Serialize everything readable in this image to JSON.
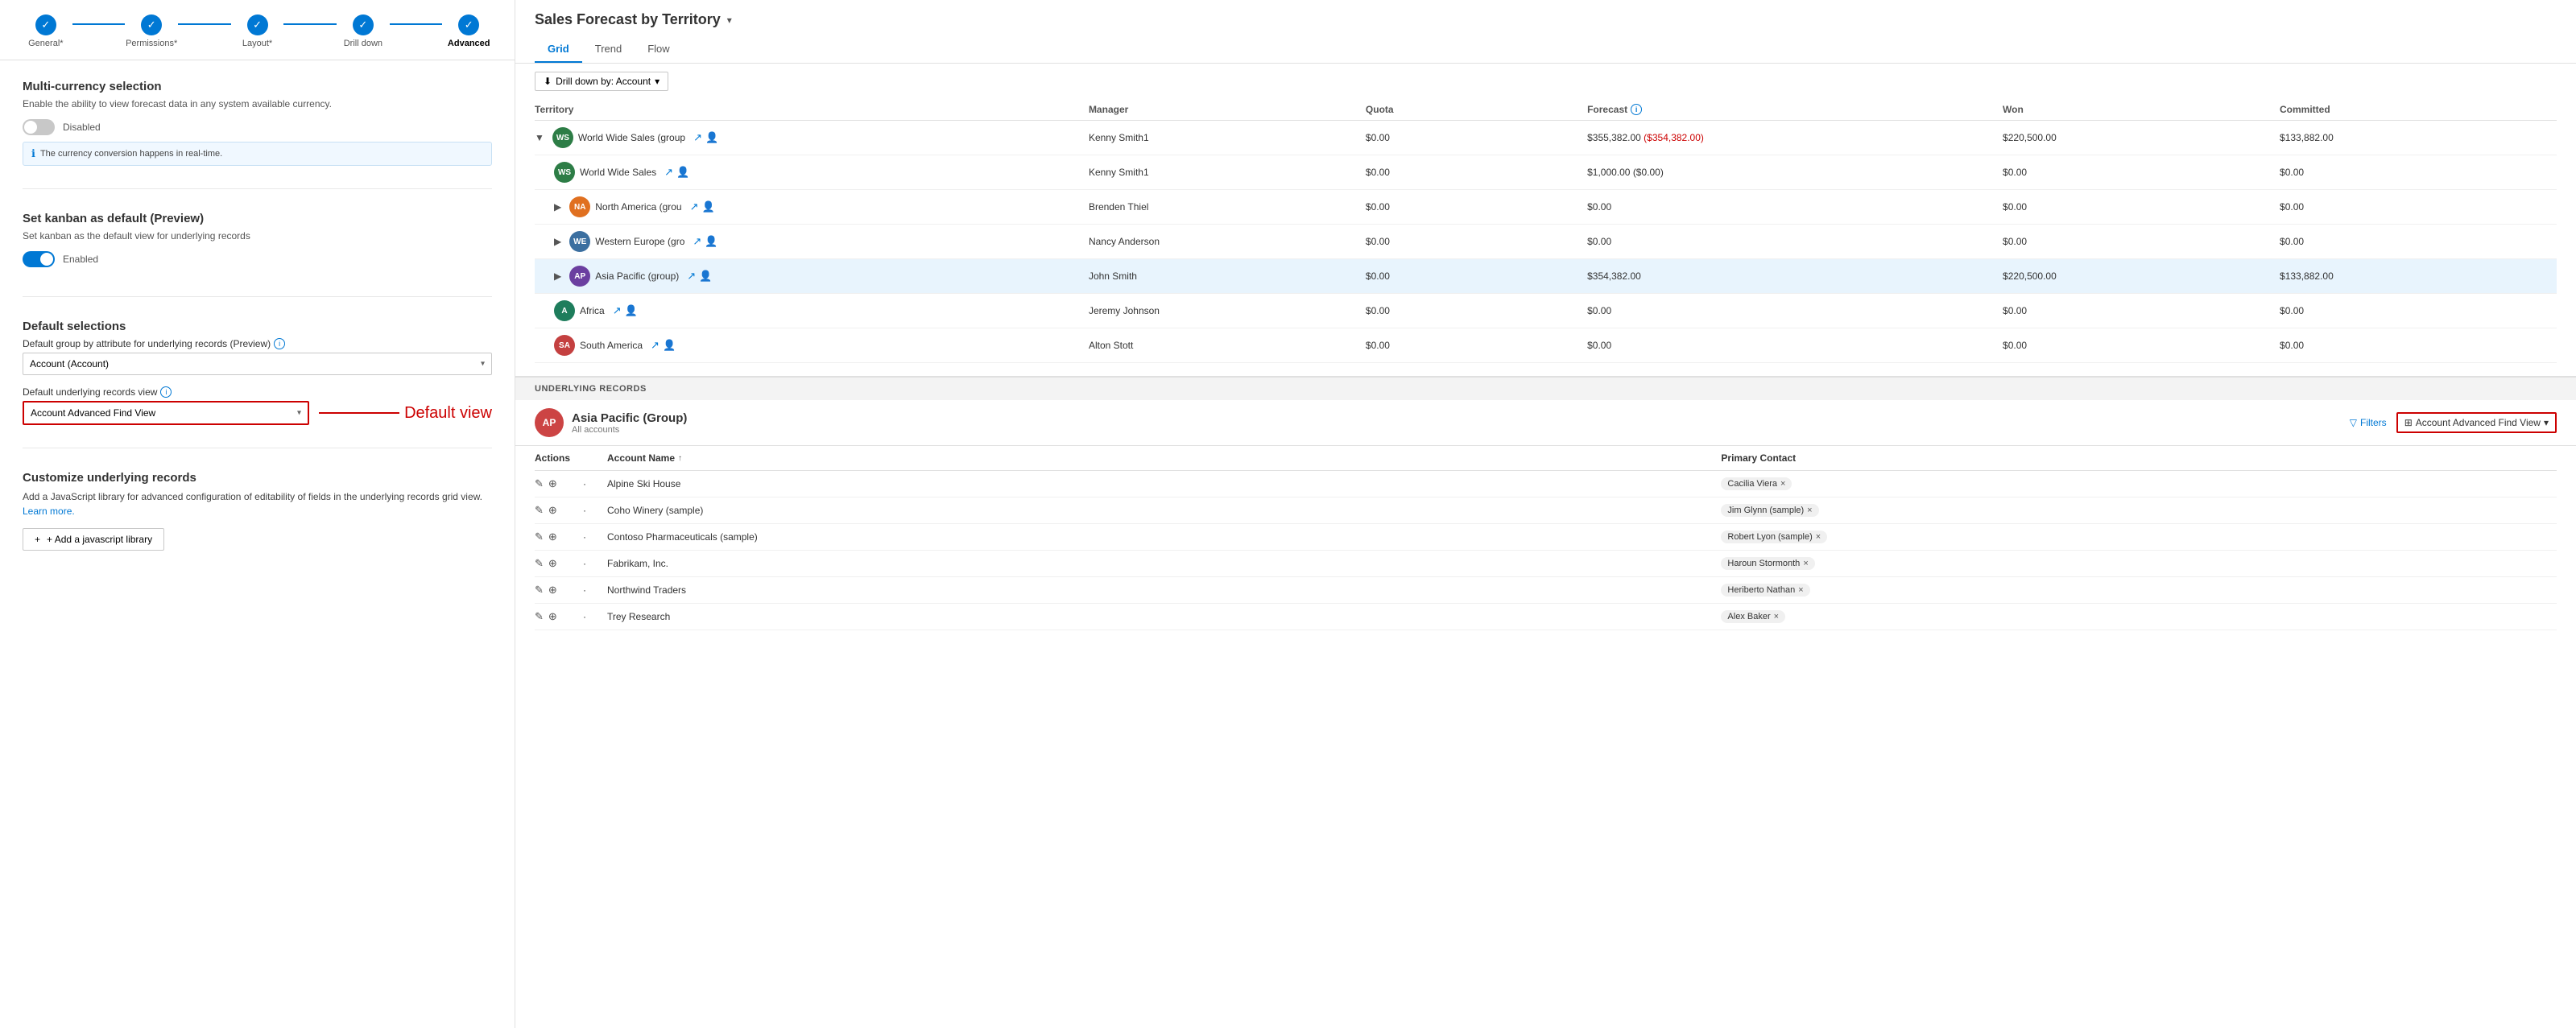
{
  "stepper": {
    "steps": [
      {
        "id": "general",
        "label": "General*",
        "active": false
      },
      {
        "id": "permissions",
        "label": "Permissions*",
        "active": false
      },
      {
        "id": "layout",
        "label": "Layout*",
        "active": false
      },
      {
        "id": "drilldown",
        "label": "Drill down",
        "active": false
      },
      {
        "id": "advanced",
        "label": "Advanced",
        "active": true
      }
    ]
  },
  "multicurrency": {
    "title": "Multi-currency selection",
    "desc": "Enable the ability to view forecast data in any system available currency.",
    "toggle_state": "off",
    "toggle_label": "Disabled",
    "info_text": "The currency conversion happens in real-time."
  },
  "kanban": {
    "title": "Set kanban as default (Preview)",
    "desc": "Set kanban as the default view for underlying records",
    "toggle_state": "on",
    "toggle_label": "Enabled"
  },
  "default_selections": {
    "title": "Default selections",
    "group_label": "Default group by attribute for underlying records (Preview)",
    "group_value": "Account (Account)",
    "view_label": "Default underlying records view",
    "view_value": "Account Advanced Find View",
    "annotation_label": "Default view"
  },
  "customize": {
    "title": "Customize underlying records",
    "desc": "Add a JavaScript library for advanced configuration of editability of fields in the underlying records grid view.",
    "link_text": "Learn more.",
    "btn_label": "+ Add a javascript library"
  },
  "forecast": {
    "title": "Sales Forecast by Territory",
    "tabs": [
      "Grid",
      "Trend",
      "Flow"
    ],
    "active_tab": "Grid",
    "drilldown_label": "Drill down by: Account",
    "columns": [
      "Territory",
      "Manager",
      "Quota",
      "Forecast",
      "Won",
      "Committed"
    ],
    "rows": [
      {
        "indent": 0,
        "collapsed": true,
        "avatar_bg": "#2d7d46",
        "avatar_text": "WS",
        "name": "World Wide Sales (group",
        "has_icons": true,
        "manager": "Kenny Smith1",
        "quota": "$0.00",
        "forecast": "$355,382.00 ($354,382.00)",
        "forecast_negative": true,
        "won": "$220,500.00",
        "committed": "$133,882.00",
        "highlighted": false
      },
      {
        "indent": 1,
        "collapsed": false,
        "avatar_bg": "#2d7d46",
        "avatar_text": "WS",
        "name": "World Wide Sales",
        "has_icons": true,
        "manager": "Kenny Smith1",
        "quota": "$0.00",
        "forecast": "$1,000.00 ($0.00)",
        "forecast_negative": false,
        "won": "$0.00",
        "committed": "$0.00",
        "highlighted": false
      },
      {
        "indent": 1,
        "collapsed": true,
        "avatar_bg": "#e07020",
        "avatar_text": "NA",
        "name": "North America (grou",
        "has_icons": true,
        "manager": "Brenden Thiel",
        "quota": "$0.00",
        "forecast": "$0.00",
        "forecast_negative": false,
        "won": "$0.00",
        "committed": "$0.00",
        "highlighted": false
      },
      {
        "indent": 1,
        "collapsed": true,
        "avatar_bg": "#3b6fa0",
        "avatar_text": "WE",
        "name": "Western Europe (gro",
        "has_icons": true,
        "manager": "Nancy Anderson",
        "quota": "$0.00",
        "forecast": "$0.00",
        "forecast_negative": false,
        "won": "$0.00",
        "committed": "$0.00",
        "highlighted": false
      },
      {
        "indent": 1,
        "collapsed": true,
        "avatar_bg": "#6b3fa0",
        "avatar_text": "AP",
        "name": "Asia Pacific (group)",
        "has_icons": true,
        "manager": "John Smith",
        "quota": "$0.00",
        "forecast": "$354,382.00",
        "forecast_negative": false,
        "won": "$220,500.00",
        "committed": "$133,882.00",
        "highlighted": true
      },
      {
        "indent": 1,
        "collapsed": false,
        "avatar_bg": "#1e7d5c",
        "avatar_text": "A",
        "name": "Africa",
        "has_icons": true,
        "manager": "Jeremy Johnson",
        "quota": "$0.00",
        "forecast": "$0.00",
        "forecast_negative": false,
        "won": "$0.00",
        "committed": "$0.00",
        "highlighted": false
      },
      {
        "indent": 1,
        "collapsed": false,
        "avatar_bg": "#c44040",
        "avatar_text": "SA",
        "name": "South America",
        "has_icons": true,
        "manager": "Alton Stott",
        "quota": "$0.00",
        "forecast": "$0.00",
        "forecast_negative": false,
        "won": "$0.00",
        "committed": "$0.00",
        "highlighted": false
      }
    ]
  },
  "underlying": {
    "header_label": "UNDERLYING RECORDS",
    "group_name": "Asia Pacific (Group)",
    "group_sub": "All accounts",
    "filter_label": "Filters",
    "view_name": "Account Advanced Find View",
    "view_chevron": "▾",
    "table_columns": [
      "Actions",
      "Account Name",
      "Primary Contact"
    ],
    "rows": [
      {
        "name": "Alpine Ski House",
        "contact": "Cacilia Viera"
      },
      {
        "name": "Coho Winery (sample)",
        "contact": "Jim Glynn (sample)"
      },
      {
        "name": "Contoso Pharmaceuticals (sample)",
        "contact": "Robert Lyon (sample)"
      },
      {
        "name": "Fabrikam, Inc.",
        "contact": "Haroun Stormonth"
      },
      {
        "name": "Northwind Traders",
        "contact": "Heriberto Nathan"
      },
      {
        "name": "Trey Research",
        "contact": "Alex Baker"
      }
    ]
  }
}
